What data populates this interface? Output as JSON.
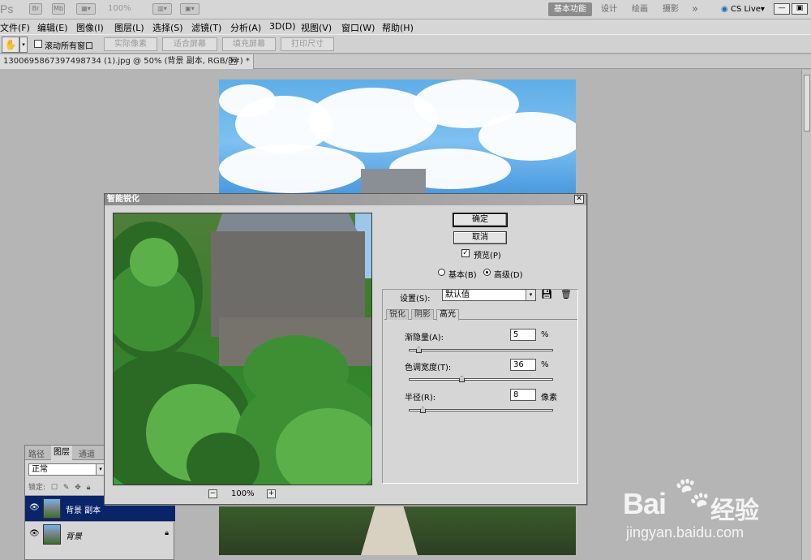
{
  "app": {
    "logo": "Ps",
    "br": "Br",
    "mb": "Mb",
    "zoom": "100%",
    "workspaces": [
      "基本功能",
      "设计",
      "绘画",
      "摄影",
      "»"
    ],
    "cslive": "CS Live"
  },
  "menu": [
    "文件(F)",
    "编辑(E)",
    "图像(I)",
    "图层(L)",
    "选择(S)",
    "滤镜(T)",
    "分析(A)",
    "3D(D)",
    "视图(V)",
    "窗口(W)",
    "帮助(H)"
  ],
  "options": {
    "scroll_all": "滚动所有窗口",
    "buttons": [
      "实际像素",
      "适合屏幕",
      "填充屏幕",
      "打印尺寸"
    ]
  },
  "document": {
    "tab_title": "1300695867397498734 (1).jpg @ 50% (背景 副本, RGB/8#) *"
  },
  "layers_panel": {
    "tabs": [
      "路径",
      "图层",
      "通道"
    ],
    "blend_mode": "正常",
    "lock_label": "锁定:",
    "layers": [
      {
        "name": "背景 副本",
        "selected": true
      },
      {
        "name": "背景",
        "selected": false
      }
    ]
  },
  "dialog": {
    "title": "智能锐化",
    "ok": "确定",
    "cancel": "取消",
    "preview_label": "预览(P)",
    "basic_label": "基本(B)",
    "advanced_label": "高级(D)",
    "settings_label": "设置(S):",
    "settings_value": "默认值",
    "tabs": [
      "锐化",
      "阴影",
      "高光"
    ],
    "zoom": "100%",
    "params": [
      {
        "label": "渐隐量(A):",
        "value": "5",
        "unit": "%",
        "level": 0.05
      },
      {
        "label": "色调宽度(T):",
        "value": "36",
        "unit": "%",
        "level": 0.36
      },
      {
        "label": "半径(R):",
        "value": "8",
        "unit": "像素",
        "level": 0.08
      }
    ]
  },
  "watermark": {
    "brand": "Bai",
    "brand2": "经验",
    "url": "jingyan.baidu.com"
  }
}
